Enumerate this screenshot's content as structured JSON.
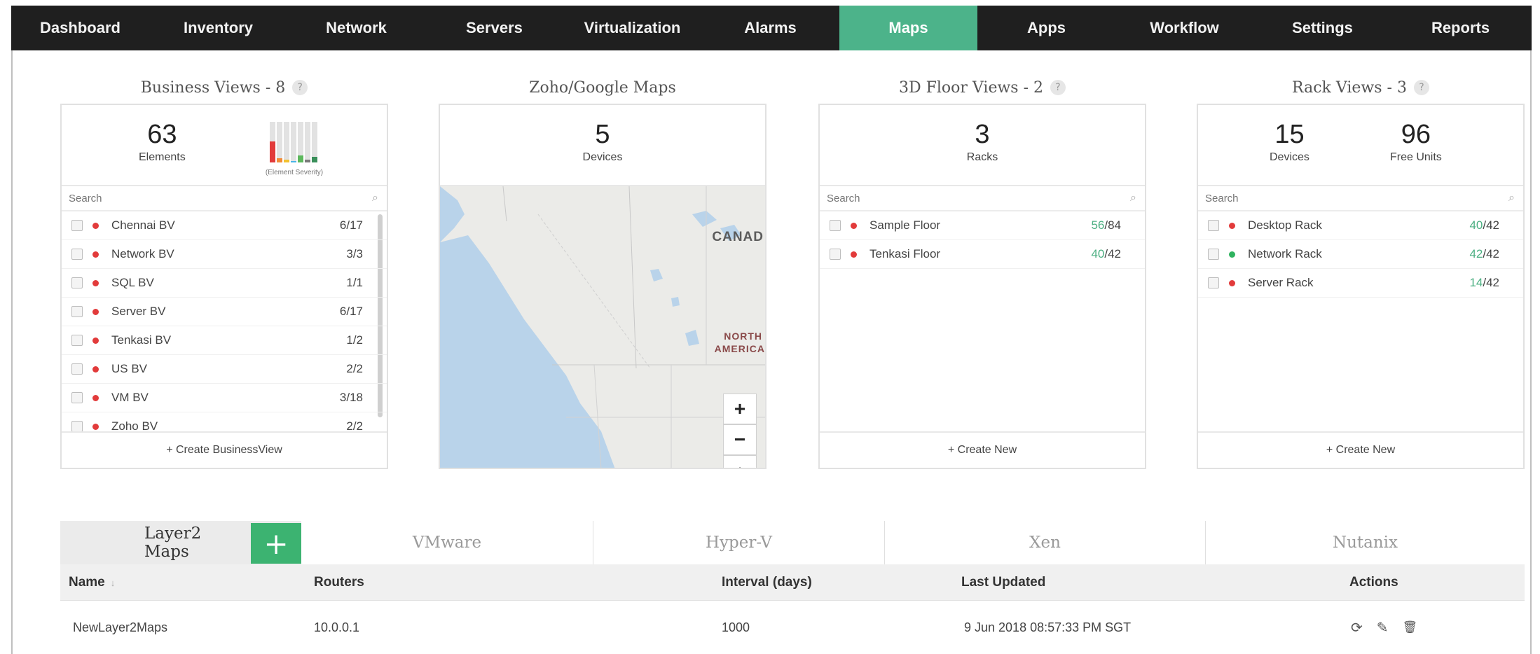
{
  "nav": [
    "Dashboard",
    "Inventory",
    "Network",
    "Servers",
    "Virtualization",
    "Alarms",
    "Maps",
    "Apps",
    "Workflow",
    "Settings",
    "Reports"
  ],
  "business_views": {
    "title": "Business Views - 8",
    "elements_count": "63",
    "elements_label": "Elements",
    "severity_label": "(Element Severity)",
    "search_placeholder": "Search",
    "items": [
      {
        "name": "Chennai BV",
        "count": "6/17",
        "status": "red"
      },
      {
        "name": "Network BV",
        "count": "3/3",
        "status": "red"
      },
      {
        "name": "SQL BV",
        "count": "1/1",
        "status": "red"
      },
      {
        "name": "Server BV",
        "count": "6/17",
        "status": "red"
      },
      {
        "name": "Tenkasi BV",
        "count": "1/2",
        "status": "red"
      },
      {
        "name": "US BV",
        "count": "2/2",
        "status": "red"
      },
      {
        "name": "VM BV",
        "count": "3/18",
        "status": "red"
      },
      {
        "name": "Zoho BV",
        "count": "2/2",
        "status": "red"
      }
    ],
    "create_label": "+ Create BusinessView"
  },
  "maps": {
    "title": "Zoho/Google Maps",
    "devices_count": "5",
    "devices_label": "Devices",
    "label_canada": "CANAD",
    "label_north": "NORTH",
    "label_america": "AMERICA",
    "zoom_in": "+",
    "zoom_out": "−",
    "compass": "▲"
  },
  "floor_views": {
    "title": "3D Floor Views - 2",
    "racks_count": "3",
    "racks_label": "Racks",
    "search_placeholder": "Search",
    "items": [
      {
        "name": "Sample Floor",
        "used": "56",
        "total": "/84",
        "status": "red"
      },
      {
        "name": "Tenkasi Floor",
        "used": "40",
        "total": "/42",
        "status": "red"
      }
    ],
    "create_label": "+ Create New"
  },
  "rack_views": {
    "title": "Rack Views - 3",
    "devices_count": "15",
    "devices_label": "Devices",
    "free_count": "96",
    "free_label": "Free Units",
    "search_placeholder": "Search",
    "items": [
      {
        "name": "Desktop Rack",
        "used": "40",
        "total": "/42",
        "status": "red"
      },
      {
        "name": "Network Rack",
        "used": "42",
        "total": "/42",
        "status": "green"
      },
      {
        "name": "Server Rack",
        "used": "14",
        "total": "/42",
        "status": "red"
      }
    ],
    "create_label": "+ Create New"
  },
  "tabs": {
    "layer2": "Layer2 Maps",
    "add": "+",
    "vmware": "VMware",
    "hyperv": "Hyper-V",
    "xen": "Xen",
    "nutanix": "Nutanix"
  },
  "table": {
    "headers": {
      "name": "Name",
      "routers": "Routers",
      "interval": "Interval (days)",
      "updated": "Last Updated",
      "actions": "Actions"
    },
    "row": {
      "name": "NewLayer2Maps",
      "routers": "10.0.0.1",
      "interval": "1000",
      "updated": "9 Jun 2018 08:57:33 PM SGT"
    }
  },
  "icons": {
    "help": "?",
    "search": "⌕",
    "sort": "↓",
    "refresh": "⟳",
    "edit": "✎",
    "delete": "🗑"
  },
  "colors": {
    "nav_bg": "#1f1f1f",
    "nav_active": "#4cb38a",
    "add_button": "#3cb371",
    "status_red": "#e23b3b",
    "status_green": "#2fb35f",
    "count_green": "#4caf82"
  }
}
